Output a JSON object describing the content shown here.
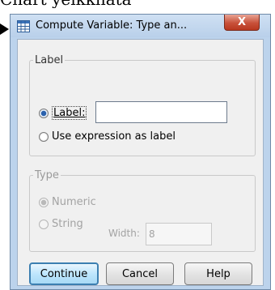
{
  "top_text": "Chart yeikkhata",
  "window": {
    "title": "Compute Variable: Type an...",
    "close_glyph": "X"
  },
  "label_group": {
    "legend": "Label",
    "option_label": "Label:",
    "option_expression": "Use expression as label",
    "label_input_value": ""
  },
  "type_group": {
    "legend": "Type",
    "option_numeric": "Numeric",
    "option_string": "String",
    "width_label": "Width:",
    "width_value": "8"
  },
  "buttons": {
    "continue": "Continue",
    "cancel": "Cancel",
    "help": "Help"
  },
  "colors": {
    "title_bar": "#bcd3ec",
    "close_button": "#c8513a",
    "dialog_bg": "#f0f0f0"
  }
}
